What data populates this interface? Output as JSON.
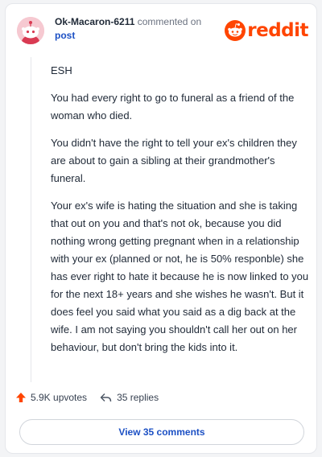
{
  "comment": {
    "username": "Ok-Macaron-6211",
    "action_text": "commented on",
    "target_text": "post",
    "brand": "reddit",
    "paragraphs": [
      "ESH",
      "You had every right to go to funeral as a friend of the woman who died.",
      "You didn't have the right to tell your ex's children they are about to gain a sibling at their grandmother's funeral.",
      "Your ex's wife is hating the situation and she is taking that out on you and that's not ok, because you did nothing wrong getting pregnant when in a relationship with your ex (planned or not, he is 50% responble) she has ever right to hate it because he is now linked to you for the next 18+ years and she wishes he wasn't. But it does feel you said what you said as a dig back at the wife. I am not saying you shouldn't call her out on her behaviour, but don't bring the kids into it."
    ]
  },
  "footer": {
    "upvotes": "5.9K upvotes",
    "replies": "35 replies",
    "view_comments": "View 35 comments"
  },
  "icons": {
    "avatar": "snoo-avatar-icon",
    "logo": "reddit-snoo-icon",
    "upvote": "upvote-arrow-icon",
    "reply": "reply-arrow-icon"
  },
  "colors": {
    "brand_orange": "#ff4500",
    "link_blue": "#1c50c4",
    "text": "#1f2937",
    "muted": "#6b7280"
  }
}
